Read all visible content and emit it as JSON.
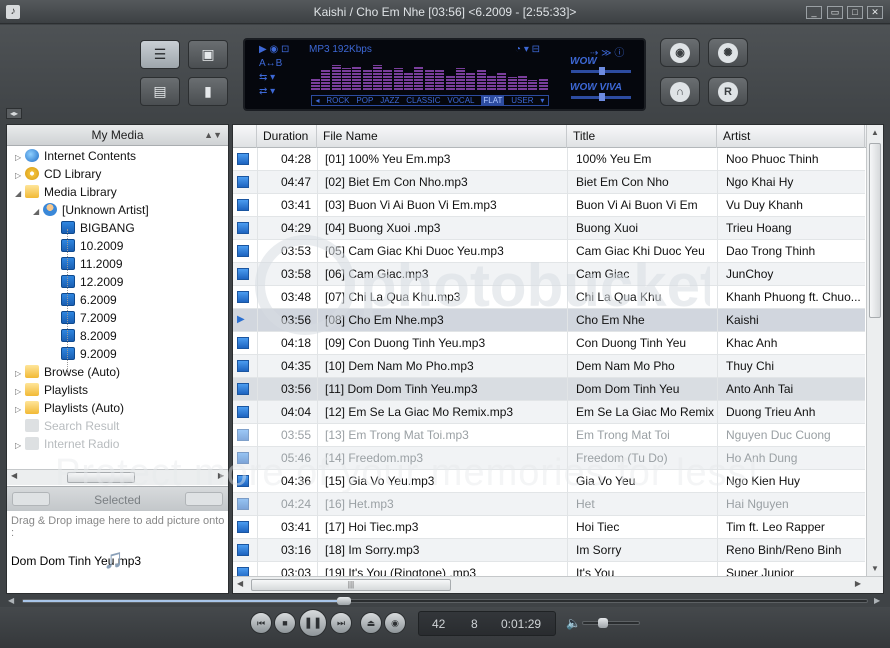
{
  "window": {
    "title": "Kaishi / Cho Em Nhe  [03:56]    <6.2009 - [2:55:33]>",
    "min": "_",
    "restore": "▭",
    "max": "□",
    "close": "✕"
  },
  "lcd": {
    "format": "MP3 192Kbps",
    "ab": "A↔B",
    "presets": [
      "ROCK",
      "POP",
      "JAZZ",
      "CLASSIC",
      "VOCAL",
      "FLAT",
      "USER"
    ],
    "selected_preset": "FLAT",
    "wow1": "WOW",
    "wow2": "WOW VIVA",
    "eq_levels": [
      0.4,
      0.7,
      0.9,
      0.8,
      0.85,
      0.75,
      0.9,
      0.7,
      0.8,
      0.6,
      0.85,
      0.7,
      0.75,
      0.55,
      0.8,
      0.65,
      0.7,
      0.5,
      0.6,
      0.45,
      0.5,
      0.35,
      0.4
    ]
  },
  "left_panel": {
    "header": "My Media",
    "tree": [
      {
        "label": "Internet Contents",
        "icon": "globe-icon",
        "level": 0,
        "expand": "▷"
      },
      {
        "label": "CD Library",
        "icon": "cd-icon",
        "level": 0,
        "expand": "▷"
      },
      {
        "label": "Media Library",
        "icon": "folder-icon",
        "level": 0,
        "expand": "◢"
      },
      {
        "label": "[Unknown Artist]",
        "icon": "artist-icon",
        "level": 1,
        "expand": "◢"
      },
      {
        "label": "BIGBANG",
        "icon": "album-icon",
        "level": 2
      },
      {
        "label": "10.2009",
        "icon": "album-icon",
        "level": 2
      },
      {
        "label": "11.2009",
        "icon": "album-icon",
        "level": 2
      },
      {
        "label": "12.2009",
        "icon": "album-icon",
        "level": 2
      },
      {
        "label": "6.2009",
        "icon": "album-icon",
        "level": 2
      },
      {
        "label": "7.2009",
        "icon": "album-icon",
        "level": 2
      },
      {
        "label": "8.2009",
        "icon": "album-icon",
        "level": 2
      },
      {
        "label": "9.2009",
        "icon": "album-icon",
        "level": 2
      },
      {
        "label": "Browse (Auto)",
        "icon": "folder-icon",
        "level": 0,
        "expand": "▷"
      },
      {
        "label": "Playlists",
        "icon": "folder-icon",
        "level": 0,
        "expand": "▷"
      },
      {
        "label": "Playlists (Auto)",
        "icon": "folder-icon",
        "level": 0,
        "expand": "▷"
      },
      {
        "label": "Search Result",
        "icon": "search-result-icon",
        "level": 0,
        "disabled": true
      },
      {
        "label": "Internet Radio",
        "icon": "radio-icon",
        "level": 0,
        "disabled": true,
        "expand": "▷"
      }
    ],
    "selected_label": "Selected",
    "drop_hint": "Drag & Drop image here to add picture onto :",
    "drop_file": "Dom Dom Tinh Yeu.mp3"
  },
  "tracklist": {
    "columns": [
      "Duration",
      "File Name",
      "Title",
      "Artist"
    ],
    "rows": [
      {
        "duration": "04:28",
        "file": "[01] 100% Yeu Em.mp3",
        "title": "100% Yeu Em",
        "artist": "Noo Phuoc Thinh"
      },
      {
        "duration": "04:47",
        "file": "[02] Biet Em Con Nho.mp3",
        "title": "Biet Em Con Nho",
        "artist": "Ngo Khai Hy"
      },
      {
        "duration": "03:41",
        "file": "[03] Buon Vi Ai Buon Vi Em.mp3",
        "title": "Buon Vi Ai Buon Vi Em",
        "artist": "Vu Duy Khanh"
      },
      {
        "duration": "04:29",
        "file": "[04] Buong Xuoi .mp3",
        "title": "Buong Xuoi",
        "artist": "Trieu Hoang"
      },
      {
        "duration": "03:53",
        "file": "[05] Cam Giac Khi Duoc Yeu.mp3",
        "title": "Cam Giac Khi Duoc Yeu",
        "artist": "Dao Trong Thinh"
      },
      {
        "duration": "03:58",
        "file": "[06] Cam Giac.mp3",
        "title": "Cam Giac",
        "artist": "JunChoy"
      },
      {
        "duration": "03:48",
        "file": "[07] Chi La Qua Khu.mp3",
        "title": "Chi La Qua Khu",
        "artist": "Khanh Phuong ft. Chuo..."
      },
      {
        "duration": "03:56",
        "file": "[08] Cho Em Nhe.mp3",
        "title": "Cho Em Nhe",
        "artist": "Kaishi",
        "state": "playing"
      },
      {
        "duration": "04:18",
        "file": "[09] Con Duong Tinh Yeu.mp3",
        "title": "Con Duong Tinh Yeu",
        "artist": "Khac Anh"
      },
      {
        "duration": "04:35",
        "file": "[10] Dem Nam Mo Pho.mp3",
        "title": "Dem Nam Mo Pho",
        "artist": "Thuy Chi"
      },
      {
        "duration": "03:56",
        "file": "[11] Dom Dom Tinh Yeu.mp3",
        "title": "Dom Dom Tinh Yeu",
        "artist": "Anto Anh Tai",
        "state": "sel"
      },
      {
        "duration": "04:04",
        "file": "[12] Em Se La Giac Mo  Remix.mp3",
        "title": "Em Se La Giac Mo  Remix",
        "artist": "Duong Trieu Anh"
      },
      {
        "duration": "03:55",
        "file": "[13] Em Trong Mat Toi.mp3",
        "title": "Em Trong Mat Toi",
        "artist": "Nguyen Duc Cuong",
        "state": "dim"
      },
      {
        "duration": "05:46",
        "file": "[14] Freedom.mp3",
        "title": "Freedom (Tu Do)",
        "artist": "Ho Anh Dung",
        "state": "dim"
      },
      {
        "duration": "04:36",
        "file": "[15] Gia Vo Yeu.mp3",
        "title": "Gia Vo Yeu",
        "artist": "Ngo Kien Huy"
      },
      {
        "duration": "04:24",
        "file": "[16] Het.mp3",
        "title": "Het",
        "artist": "Hai Nguyen",
        "state": "dim"
      },
      {
        "duration": "03:41",
        "file": "[17] Hoi Tiec.mp3",
        "title": "Hoi Tiec",
        "artist": "Tim ft. Leo Rapper"
      },
      {
        "duration": "03:16",
        "file": "[18] Im Sorry.mp3",
        "title": "Im Sorry",
        "artist": "Reno Binh/Reno Binh"
      },
      {
        "duration": "03:03",
        "file": "[19] It's You (Ringtone) .mp3",
        "title": "It's You",
        "artist": "Super Junior"
      }
    ]
  },
  "watermark": {
    "logo": "photobucket",
    "tagline": "Protect more of your memories for less!"
  },
  "status": {
    "num1": "42",
    "num2": "8",
    "elapsed": "0:01:29",
    "seek_fraction": 0.38,
    "volume_fraction": 0.35
  }
}
